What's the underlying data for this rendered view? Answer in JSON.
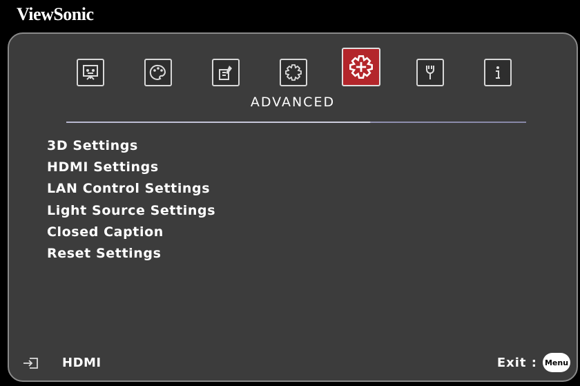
{
  "brand": "ViewSonic",
  "tabs": [
    {
      "icon": "display-icon",
      "active": false
    },
    {
      "icon": "palette-icon",
      "active": false
    },
    {
      "icon": "power-management-icon",
      "active": false
    },
    {
      "icon": "basic-settings-gear-icon",
      "active": false
    },
    {
      "icon": "advanced-settings-gear-icon",
      "active": true
    },
    {
      "icon": "system-wrench-icon",
      "active": false
    },
    {
      "icon": "information-icon",
      "active": false
    }
  ],
  "active_tab_label": "ADVANCED",
  "menu_items": [
    "3D Settings",
    "HDMI Settings",
    "LAN Control Settings",
    "Light Source Settings",
    "Closed Caption",
    "Reset Settings"
  ],
  "footer": {
    "source_icon": "input-source-icon",
    "source_label": "HDMI",
    "exit_label": "Exit :",
    "menu_button_label": "Menu"
  },
  "colors": {
    "panel_bg": "#3c3c3c",
    "active_tab_bg": "#b3262b",
    "text": "#ffffff"
  }
}
